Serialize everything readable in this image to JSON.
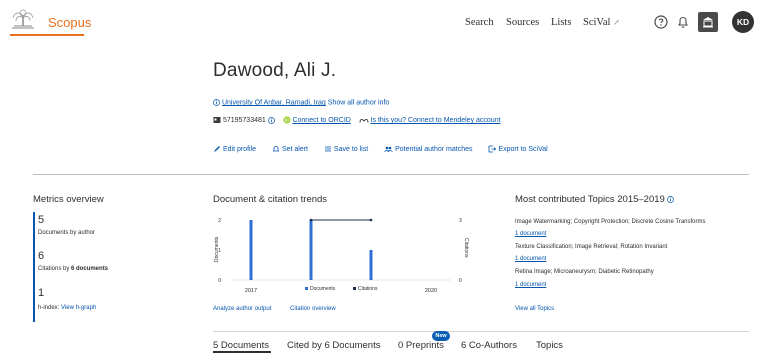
{
  "header": {
    "brand": "Scopus",
    "nav": {
      "search": "Search",
      "sources": "Sources",
      "lists": "Lists",
      "scival": "SciVal",
      "scival_ext": "↗"
    },
    "avatar_initials": "KD",
    "icons": [
      "elsevier-logo-icon",
      "help-icon",
      "bell-icon",
      "institution-icon"
    ]
  },
  "author": {
    "name": "Dawood, Ali J.",
    "affiliation": "University Of Anbar, Ramadi, Iraq",
    "show_all": "Show all author info",
    "scopus_id": "57195733481",
    "orcid_link": "Connect to ORCID",
    "mendeley_link": "Is this you? Connect to Mendeley account"
  },
  "actions": {
    "edit": "Edit profile",
    "alert": "Set alert",
    "save": "Save to list",
    "matches": "Potential author matches",
    "export": "Export to SciVal"
  },
  "metrics": {
    "title": "Metrics overview",
    "docs_value": "5",
    "docs_label": "Documents by author",
    "cit_value": "6",
    "cit_label_prefix": "Citations by ",
    "cit_label_bold": "6 documents",
    "h_value": "1",
    "h_label": "h-index:",
    "h_link": "View h-graph"
  },
  "trends": {
    "title": "Document & citation trends",
    "analyze_link": "Analyze author output",
    "citation_link": "Citation overview"
  },
  "chart_data": {
    "type": "bar",
    "x": [
      2017,
      2018,
      2019
    ],
    "xtick_labels": [
      "2017",
      "2020"
    ],
    "series": [
      {
        "name": "Documents",
        "type": "bar",
        "axis": "left",
        "values": [
          2,
          2,
          1
        ],
        "color": "#2f6fd6"
      },
      {
        "name": "Citations",
        "type": "line",
        "axis": "right",
        "values": [
          null,
          3,
          3
        ],
        "color": "#1f2d4f"
      }
    ],
    "ylabel_left": "Documents",
    "ylabel_right": "Citations",
    "yleft_ticks": [
      "0",
      "1",
      "2"
    ],
    "yright_ticks": [
      "0",
      "3"
    ],
    "ylim_left": [
      0,
      2
    ],
    "ylim_right": [
      0,
      3
    ],
    "legend": "bottom"
  },
  "topics": {
    "title": "Most contributed Topics 2015–2019",
    "items": [
      {
        "name": "Image Watermarking; Copyright Protection; Discrete Cosine Transforms",
        "docs": "1 document"
      },
      {
        "name": "Texture Classification; Image Retrieval; Rotation Invariant",
        "docs": "1 document"
      },
      {
        "name": "Retina Image; Microaneurysm; Diabetic Retinopathy",
        "docs": "1 document"
      }
    ],
    "view_all": "View all Topics"
  },
  "tabs": {
    "documents": "5 Documents",
    "cited_by": "Cited by 6 Documents",
    "preprints": "0 Preprints",
    "preprints_badge": "New",
    "coauthors": "6 Co-Authors",
    "topics": "Topics"
  }
}
